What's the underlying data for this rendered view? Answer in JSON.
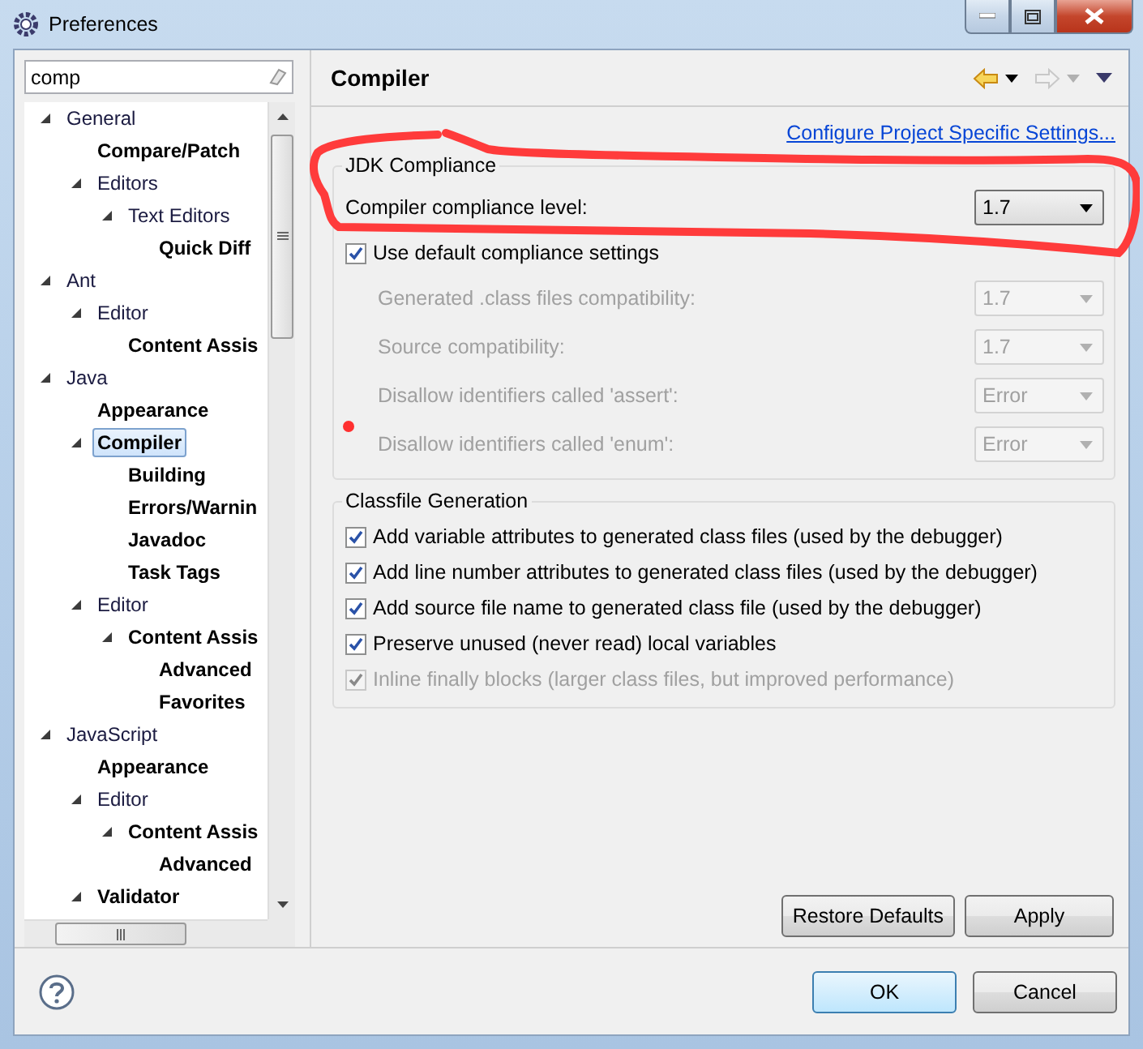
{
  "window": {
    "title": "Preferences"
  },
  "filter": {
    "value": "comp"
  },
  "tree": [
    {
      "label": "General",
      "bold": false,
      "selected": false,
      "expanded": true,
      "children": [
        {
          "label": "Compare/Patch",
          "bold": true,
          "selected": false
        },
        {
          "label": "Editors",
          "bold": false,
          "selected": false,
          "expanded": true,
          "children": [
            {
              "label": "Text Editors",
              "bold": false,
              "selected": false,
              "expanded": true,
              "children": [
                {
                  "label": "Quick Diff",
                  "bold": true,
                  "selected": false
                }
              ]
            }
          ]
        }
      ]
    },
    {
      "label": "Ant",
      "bold": false,
      "selected": false,
      "expanded": true,
      "children": [
        {
          "label": "Editor",
          "bold": false,
          "selected": false,
          "expanded": true,
          "children": [
            {
              "label": "Content Assis",
              "bold": true,
              "selected": false
            }
          ]
        }
      ]
    },
    {
      "label": "Java",
      "bold": false,
      "selected": false,
      "expanded": true,
      "children": [
        {
          "label": "Appearance",
          "bold": true,
          "selected": false
        },
        {
          "label": "Compiler",
          "bold": true,
          "selected": true,
          "expanded": true,
          "children": [
            {
              "label": "Building",
              "bold": true,
              "selected": false
            },
            {
              "label": "Errors/Warnin",
              "bold": true,
              "selected": false
            },
            {
              "label": "Javadoc",
              "bold": true,
              "selected": false
            },
            {
              "label": "Task Tags",
              "bold": true,
              "selected": false
            }
          ]
        },
        {
          "label": "Editor",
          "bold": false,
          "selected": false,
          "expanded": true,
          "children": [
            {
              "label": "Content Assis",
              "bold": true,
              "selected": false,
              "expanded": true,
              "children": [
                {
                  "label": "Advanced",
                  "bold": true,
                  "selected": false
                },
                {
                  "label": "Favorites",
                  "bold": true,
                  "selected": false
                }
              ]
            }
          ]
        }
      ]
    },
    {
      "label": "JavaScript",
      "bold": false,
      "selected": false,
      "expanded": true,
      "children": [
        {
          "label": "Appearance",
          "bold": true,
          "selected": false
        },
        {
          "label": "Editor",
          "bold": false,
          "selected": false,
          "expanded": true,
          "children": [
            {
              "label": "Content Assis",
              "bold": true,
              "selected": false,
              "expanded": true,
              "children": [
                {
                  "label": "Advanced",
                  "bold": true,
                  "selected": false
                }
              ]
            }
          ]
        },
        {
          "label": "Validator",
          "bold": true,
          "selected": false,
          "expanded": true
        }
      ]
    }
  ],
  "page": {
    "title": "Compiler",
    "link": "Configure Project Specific Settings...",
    "jdk_group": {
      "title": "JDK Compliance",
      "compliance": {
        "label": "Compiler compliance level:",
        "value": "1.7",
        "disabled": false
      },
      "use_default": {
        "label": "Use default compliance settings",
        "checked": true
      },
      "settings": [
        {
          "label": "Generated .class files compatibility:",
          "value": "1.7",
          "disabled": true
        },
        {
          "label": "Source compatibility:",
          "value": "1.7",
          "disabled": true
        },
        {
          "label": "Disallow identifiers called 'assert':",
          "value": "Error",
          "disabled": true
        },
        {
          "label": "Disallow identifiers called 'enum':",
          "value": "Error",
          "disabled": true
        }
      ]
    },
    "classfile_group": {
      "title": "Classfile Generation",
      "options": [
        {
          "label": "Add variable attributes to generated class files (used by the debugger)",
          "checked": true,
          "disabled": false
        },
        {
          "label": "Add line number attributes to generated class files (used by the debugger)",
          "checked": true,
          "disabled": false
        },
        {
          "label": "Add source file name to generated class file (used by the debugger)",
          "checked": true,
          "disabled": false
        },
        {
          "label": "Preserve unused (never read) local variables",
          "checked": true,
          "disabled": false
        },
        {
          "label": "Inline finally blocks (larger class files, but improved performance)",
          "checked": true,
          "disabled": true
        }
      ]
    },
    "page_buttons": [
      {
        "label": "Restore Defaults",
        "default": false
      },
      {
        "label": "Apply",
        "default": false
      }
    ]
  },
  "dialog_buttons": [
    {
      "label": "OK",
      "default": true
    },
    {
      "label": "Cancel",
      "default": false
    }
  ]
}
